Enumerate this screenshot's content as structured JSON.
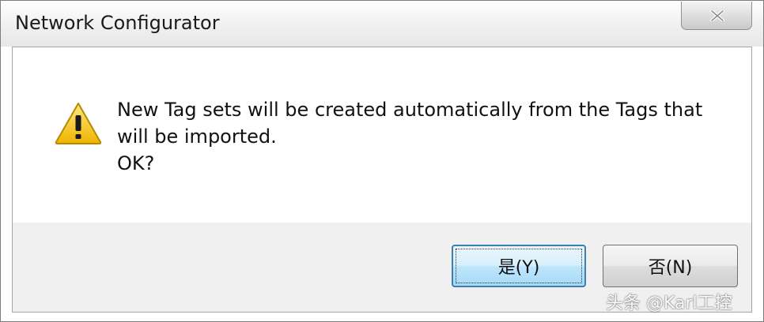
{
  "window": {
    "title": "Network Configurator"
  },
  "message": {
    "lines": [
      "New Tag sets will be created automatically from the Tags that",
      "will be imported.",
      "OK?"
    ],
    "icon": "warning-icon"
  },
  "buttons": {
    "yes_label": "是(Y)",
    "no_label": "否(N)"
  },
  "watermark": "头条 @Karl工控",
  "colors": {
    "warning_yellow": "#f5c400",
    "focus_border": "#3c7fb1"
  }
}
